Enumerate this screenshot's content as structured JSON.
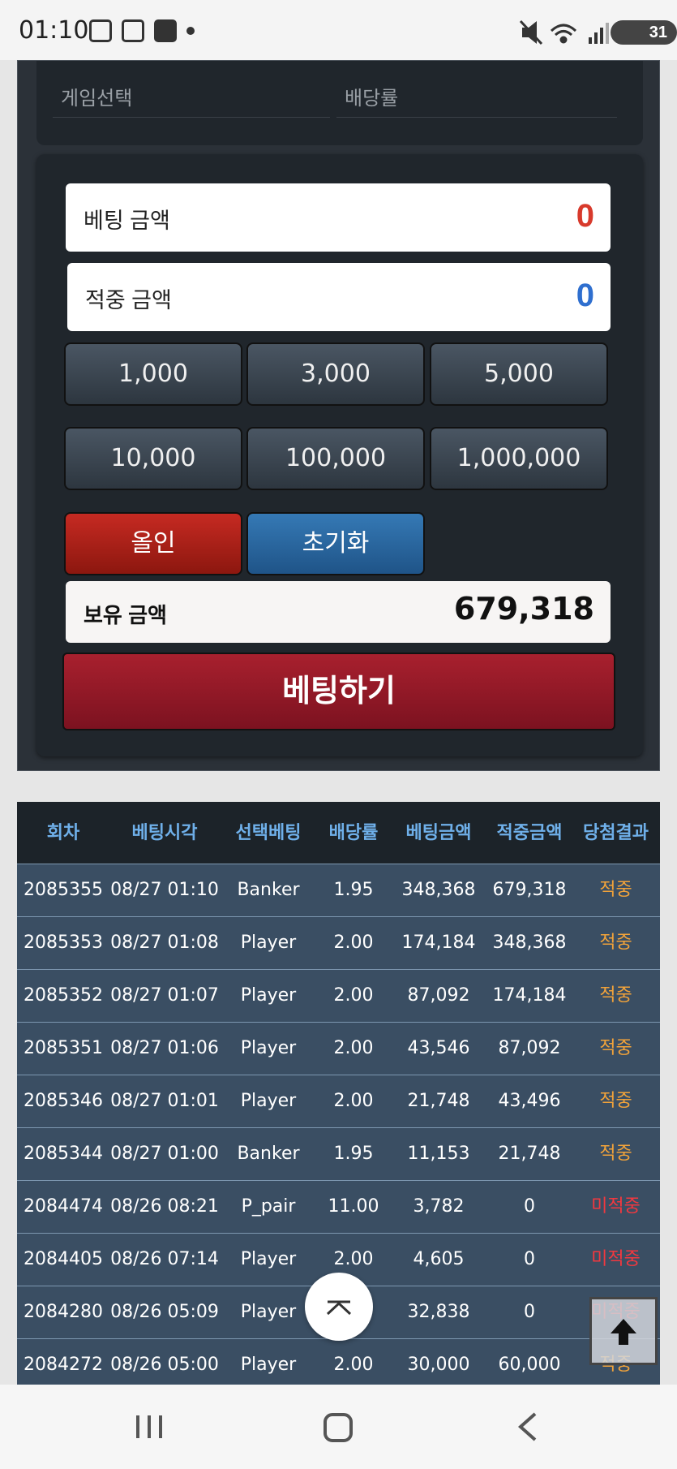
{
  "statusbar": {
    "time": "01:10",
    "battery": "31"
  },
  "top_fields": {
    "game_select": "게임선택",
    "odds": "배당률"
  },
  "bet_panel": {
    "bet_amount_label": "베팅 금액",
    "bet_amount_value": "0",
    "win_amount_label": "적중 금액",
    "win_amount_value": "0",
    "chips": [
      "1,000",
      "3,000",
      "5,000",
      "10,000",
      "100,000",
      "1,000,000"
    ],
    "allin_label": "올인",
    "reset_label": "초기화",
    "holding_label": "보유 금액",
    "holding_value": "679,318",
    "bet_button_label": "베팅하기"
  },
  "colors": {
    "bet_value": "#d83a2c",
    "win_value": "#2f6fcf",
    "hit": "#f2a33a",
    "miss": "#f2383f"
  },
  "history": {
    "headers": [
      "회차",
      "베팅시각",
      "선택베팅",
      "배당률",
      "베팅금액",
      "적중금액",
      "당첨결과"
    ],
    "rows": [
      [
        "2085355",
        "08/27 01:10",
        "Banker",
        "1.95",
        "348,368",
        "679,318",
        "적중"
      ],
      [
        "2085353",
        "08/27 01:08",
        "Player",
        "2.00",
        "174,184",
        "348,368",
        "적중"
      ],
      [
        "2085352",
        "08/27 01:07",
        "Player",
        "2.00",
        "87,092",
        "174,184",
        "적중"
      ],
      [
        "2085351",
        "08/27 01:06",
        "Player",
        "2.00",
        "43,546",
        "87,092",
        "적중"
      ],
      [
        "2085346",
        "08/27 01:01",
        "Player",
        "2.00",
        "21,748",
        "43,496",
        "적중"
      ],
      [
        "2085344",
        "08/27 01:00",
        "Banker",
        "1.95",
        "11,153",
        "21,748",
        "적중"
      ],
      [
        "2084474",
        "08/26 08:21",
        "P_pair",
        "11.00",
        "3,782",
        "0",
        "미적중"
      ],
      [
        "2084405",
        "08/26 07:14",
        "Player",
        "2.00",
        "4,605",
        "0",
        "미적중"
      ],
      [
        "2084280",
        "08/26 05:09",
        "Player",
        "",
        "32,838",
        "0",
        "미적중"
      ],
      [
        "2084272",
        "08/26 05:00",
        "Player",
        "2.00",
        "30,000",
        "60,000",
        "적중"
      ]
    ]
  },
  "icons": {
    "scroll_up": "chevron-up-icon",
    "to_top": "arrow-up-icon"
  }
}
